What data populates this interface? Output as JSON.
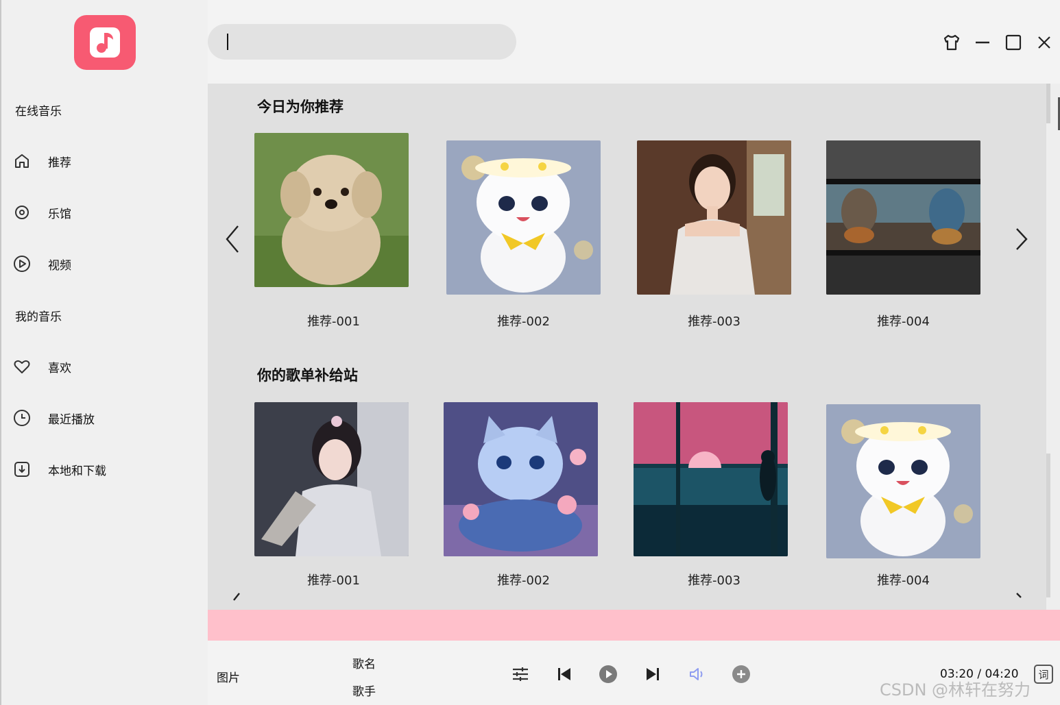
{
  "app": {
    "logo_icon": "music-note-icon",
    "brand_color": "#f75a72"
  },
  "sidebar": {
    "online_title": "在线音乐",
    "my_music_title": "我的音乐",
    "items": [
      {
        "label": "推荐",
        "icon": "home-icon"
      },
      {
        "label": "乐馆",
        "icon": "disc-icon"
      },
      {
        "label": "视频",
        "icon": "play-circle-icon"
      },
      {
        "label": "喜欢",
        "icon": "heart-icon"
      },
      {
        "label": "最近播放",
        "icon": "clock-icon"
      },
      {
        "label": "本地和下载",
        "icon": "download-icon"
      }
    ]
  },
  "search": {
    "value": ""
  },
  "window_controls": [
    "skin-icon",
    "minimize-icon",
    "maximize-icon",
    "close-icon"
  ],
  "sections": [
    {
      "title": "今日为你推荐",
      "cards": [
        {
          "label": "推荐-001"
        },
        {
          "label": "推荐-002"
        },
        {
          "label": "推荐-003"
        },
        {
          "label": "推荐-004"
        }
      ]
    },
    {
      "title": "你的歌单补给站",
      "cards": [
        {
          "label": "推荐-001"
        },
        {
          "label": "推荐-002"
        },
        {
          "label": "推荐-003"
        },
        {
          "label": "推荐-004"
        }
      ]
    }
  ],
  "player": {
    "picture_label": "图片",
    "song_label": "歌名",
    "artist_label": "歌手",
    "time": "03:20 /  04:20",
    "lyric_label": "词",
    "controls": [
      "equalizer-icon",
      "previous-icon",
      "play-icon",
      "next-icon",
      "volume-icon",
      "add-icon"
    ],
    "volume_color": "#8e9cf0"
  },
  "watermark": "CSDN @林轩在努力",
  "colors": {
    "content_bg": "#e0e0e0",
    "pink_bar": "#ffc0cb"
  }
}
